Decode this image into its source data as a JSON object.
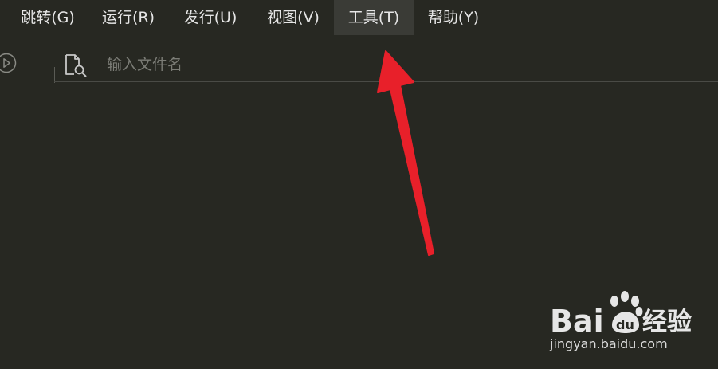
{
  "menu": {
    "items": [
      {
        "label": "跳转(G)"
      },
      {
        "label": "运行(R)"
      },
      {
        "label": "发行(U)"
      },
      {
        "label": "视图(V)"
      },
      {
        "label": "工具(T)"
      },
      {
        "label": "帮助(Y)"
      }
    ],
    "active_item": "工具(T)"
  },
  "toolbar": {
    "search": {
      "value": "",
      "placeholder": "输入文件名"
    },
    "icons": {
      "run": "play-circle-icon",
      "search": "file-search-icon"
    }
  },
  "annotation": {
    "arrow_color": "#e8202a",
    "arrow_target": "工具(T)"
  },
  "watermark": {
    "logo_text": "Bai du 经验",
    "url": "jingyan.baidu.com"
  },
  "colors": {
    "background": "#272822",
    "menu_active": "#3a3b36",
    "text": "#e6e6e6",
    "placeholder": "#7b7c76"
  }
}
